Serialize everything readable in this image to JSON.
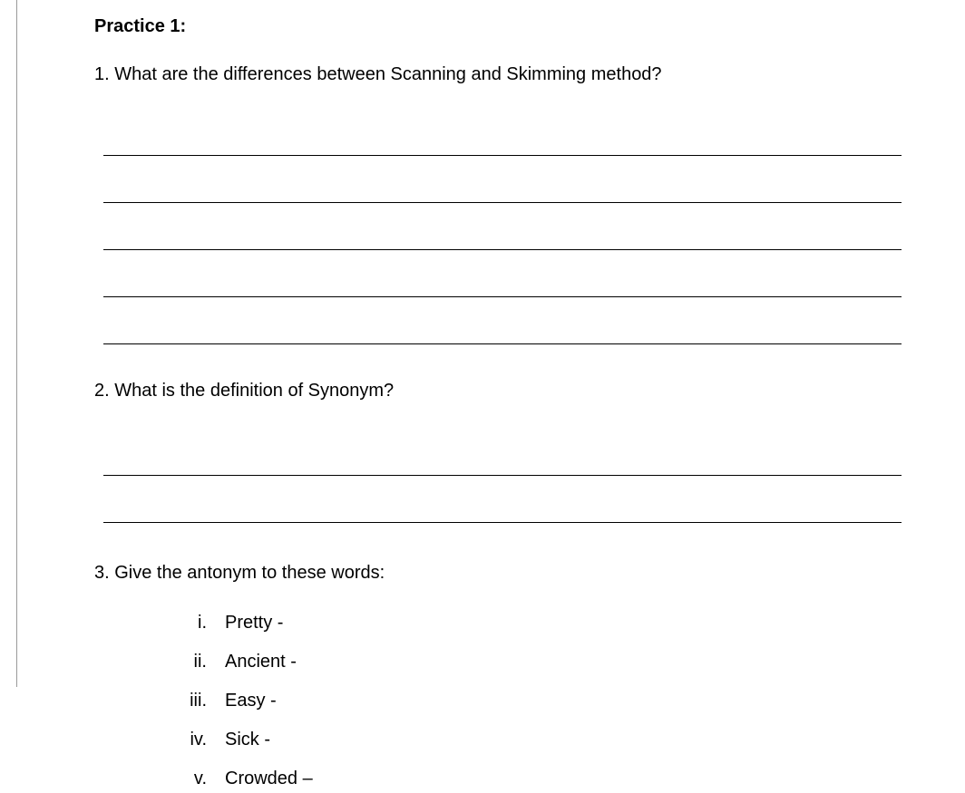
{
  "heading": "Practice 1:",
  "q1": {
    "text": "1. What are the differences between Scanning and Skimming method?",
    "blankLines": 5
  },
  "q2": {
    "text": "2. What is the definition of Synonym?",
    "blankLines": 2
  },
  "q3": {
    "text": "3. Give the antonym to these words:",
    "items": [
      {
        "numeral": "i.",
        "word": "Pretty -"
      },
      {
        "numeral": "ii.",
        "word": "Ancient -"
      },
      {
        "numeral": "iii.",
        "word": "Easy -"
      },
      {
        "numeral": "iv.",
        "word": "Sick -"
      },
      {
        "numeral": "v.",
        "word": "Crowded –"
      }
    ]
  }
}
